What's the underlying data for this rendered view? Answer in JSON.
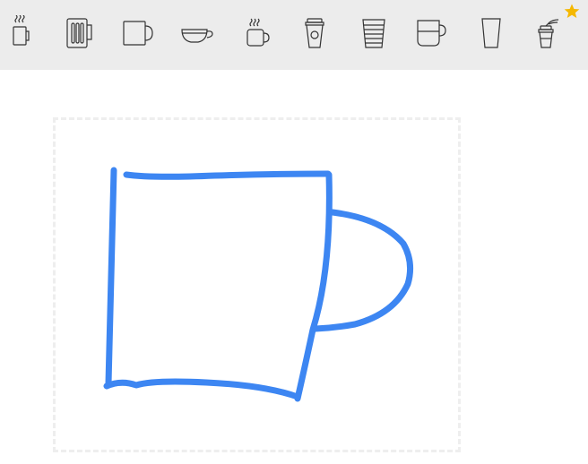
{
  "toolbar": {
    "icons": [
      {
        "name": "hot-coffee-cup-icon"
      },
      {
        "name": "beer-mug-icon"
      },
      {
        "name": "coffee-mug-icon"
      },
      {
        "name": "teacup-icon"
      },
      {
        "name": "hot-mug-icon"
      },
      {
        "name": "takeaway-coffee-cup-icon"
      },
      {
        "name": "paper-cup-icon"
      },
      {
        "name": "filled-mug-icon"
      },
      {
        "name": "glass-icon"
      },
      {
        "name": "iced-drink-cup-icon"
      }
    ],
    "favorite_icon": "star-icon"
  },
  "colors": {
    "toolbar_bg": "#ececec",
    "icon_stroke": "#333333",
    "star": "#f5b800",
    "drawing_stroke": "#3d86f2",
    "canvas_border": "#eeeeee"
  },
  "canvas": {
    "drawing": "hand-drawn-mug-sketch"
  }
}
